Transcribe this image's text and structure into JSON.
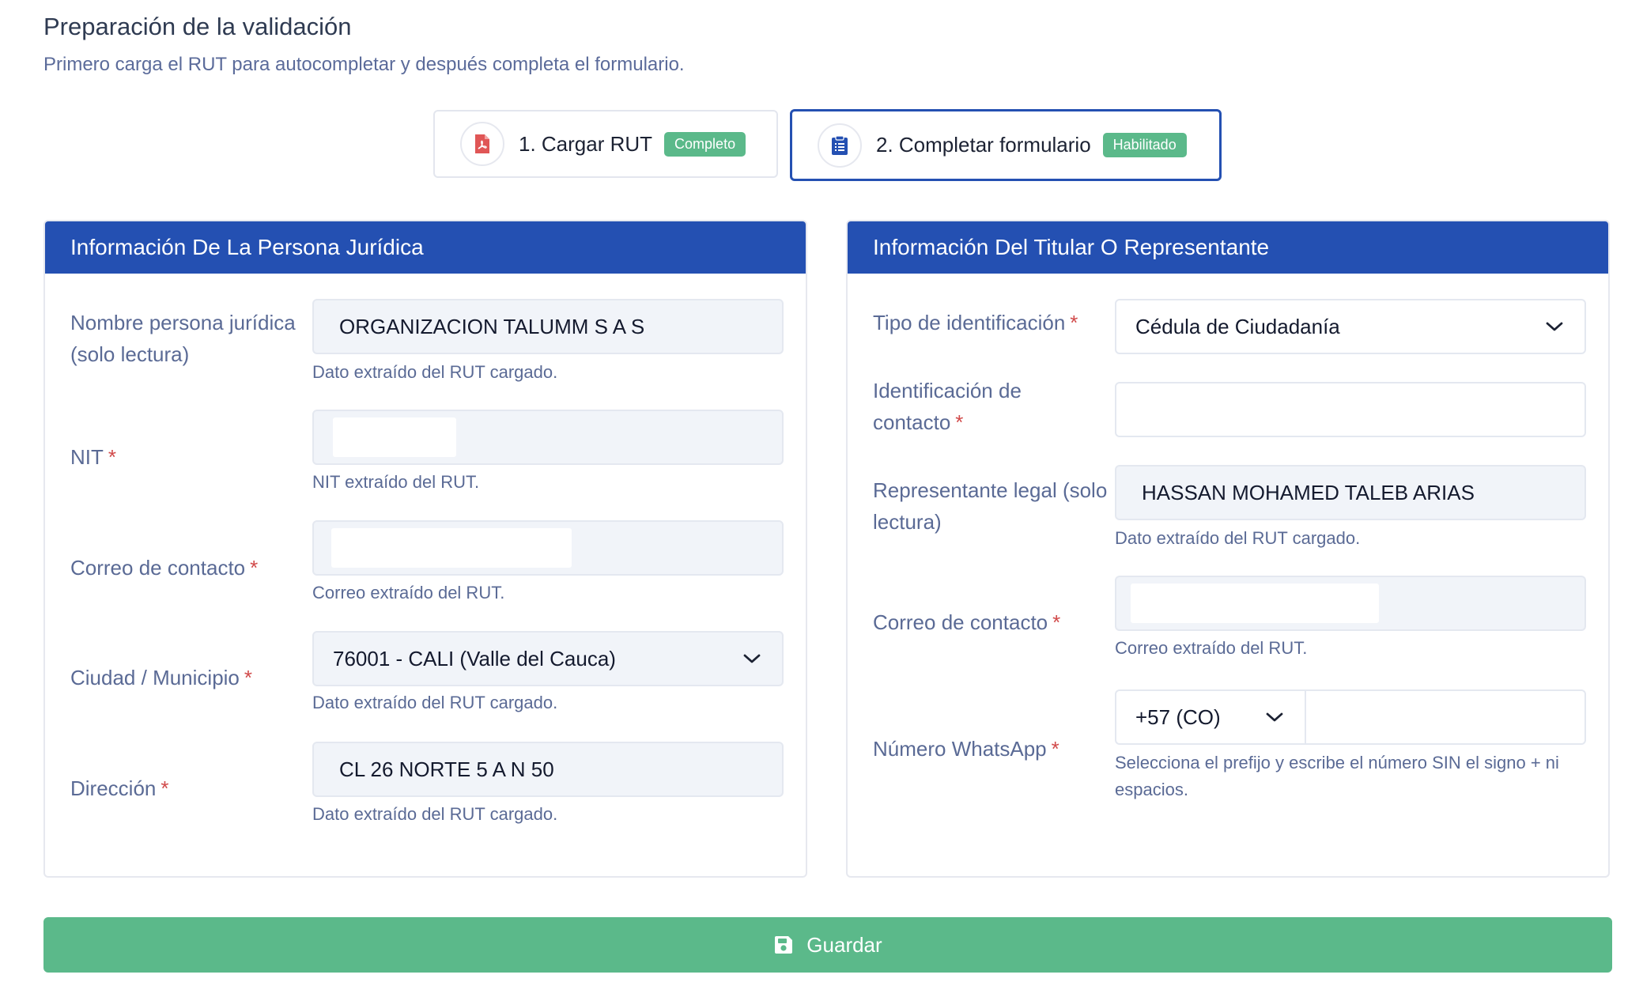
{
  "page": {
    "title": "Preparación de la validación",
    "subtitle": "Primero carga el RUT para autocompletar y después completa el formulario."
  },
  "steps": [
    {
      "label": "1. Cargar RUT",
      "badge": "Completo",
      "icon": "pdf-file-icon",
      "state": "completed"
    },
    {
      "label": "2. Completar formulario",
      "badge": "Habilitado",
      "icon": "clipboard-list-icon",
      "state": "active"
    }
  ],
  "left_card": {
    "header": "Información De La Persona Jurídica",
    "fields": {
      "nombre": {
        "label": "Nombre persona jurídica (solo lectura)",
        "value": "ORGANIZACION TALUMM S A S",
        "help": "Dato extraído del RUT cargado."
      },
      "nit": {
        "label": "NIT",
        "required": "*",
        "value": "",
        "help": "NIT extraído del RUT."
      },
      "correo": {
        "label": "Correo de contacto",
        "required": "*",
        "value": "",
        "help": "Correo extraído del RUT."
      },
      "ciudad": {
        "label": "Ciudad / Municipio",
        "required": "*",
        "value": "76001 - CALI (Valle del Cauca)",
        "help": "Dato extraído del RUT cargado."
      },
      "direccion": {
        "label": "Dirección",
        "required": "*",
        "value": "CL 26 NORTE 5 A N 50",
        "help": "Dato extraído del RUT cargado."
      }
    }
  },
  "right_card": {
    "header": "Información Del Titular O Representante",
    "fields": {
      "tipo_id": {
        "label": "Tipo de identificación",
        "required": "*",
        "value": "Cédula de Ciudadanía"
      },
      "identificacion": {
        "label_line1": "Identificación de",
        "label_line2": "contacto",
        "required": "*",
        "value": ""
      },
      "representante": {
        "label": "Representante legal (solo lectura)",
        "value": "HASSAN MOHAMED TALEB ARIAS",
        "help": "Dato extraído del RUT cargado."
      },
      "correo": {
        "label": "Correo de contacto",
        "required": "*",
        "value": "",
        "help": "Correo extraído del RUT."
      },
      "whatsapp": {
        "label": "Número WhatsApp",
        "required": "*",
        "prefix": "+57 (CO)",
        "value": "",
        "help": "Selecciona el prefijo y escribe el número SIN el signo + ni espacios."
      }
    }
  },
  "actions": {
    "save_label": "Guardar"
  },
  "colors": {
    "primary": "#2450b2",
    "success": "#5bb98a",
    "required": "#d14a4a",
    "muted_text": "#5a6a95"
  }
}
